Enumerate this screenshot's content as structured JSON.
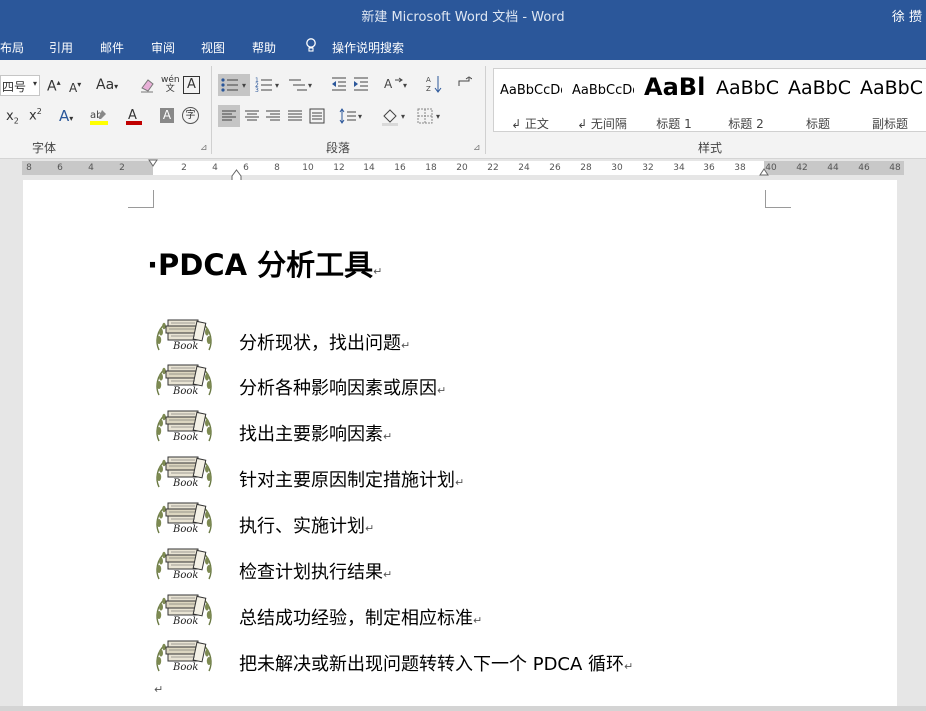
{
  "window": {
    "title": "新建 Microsoft Word 文档  -  Word",
    "user": "徐 攒"
  },
  "tabs": [
    "布局",
    "引用",
    "邮件",
    "审阅",
    "视图",
    "帮助"
  ],
  "tell_me": "操作说明搜索",
  "ribbon": {
    "font_size": "四号",
    "change_case": "Aa",
    "phonetic": "wén",
    "groups": {
      "font": "字体",
      "paragraph": "段落",
      "styles": "样式"
    },
    "styles": [
      {
        "sample": "AaBbCcDd",
        "name": "↲ 正文"
      },
      {
        "sample": "AaBbCcDd",
        "name": "↲ 无间隔"
      },
      {
        "sample": "AaBl",
        "name": "标题 1"
      },
      {
        "sample": "AaBbC",
        "name": "标题 2"
      },
      {
        "sample": "AaBbC",
        "name": "标题"
      },
      {
        "sample": "AaBbC",
        "name": "副标题"
      }
    ]
  },
  "ruler": [
    "8",
    "6",
    "4",
    "2",
    "2",
    "4",
    "6",
    "8",
    "10",
    "12",
    "14",
    "16",
    "18",
    "20",
    "22",
    "24",
    "26",
    "28",
    "30",
    "32",
    "34",
    "36",
    "38",
    "40",
    "42",
    "44",
    "46",
    "48"
  ],
  "document": {
    "heading": "·PDCA 分析工具",
    "icon_label": "Book",
    "items": [
      "分析现状，找出问题",
      "分析各种影响因素或原因",
      "找出主要影响因素",
      "针对主要原因制定措施计划",
      "执行、实施计划",
      "检查计划执行结果",
      "总结成功经验，制定相应标准",
      "把未解决或新出现问题转转入下一个 PDCA 循环"
    ],
    "return_mark": "↵"
  }
}
